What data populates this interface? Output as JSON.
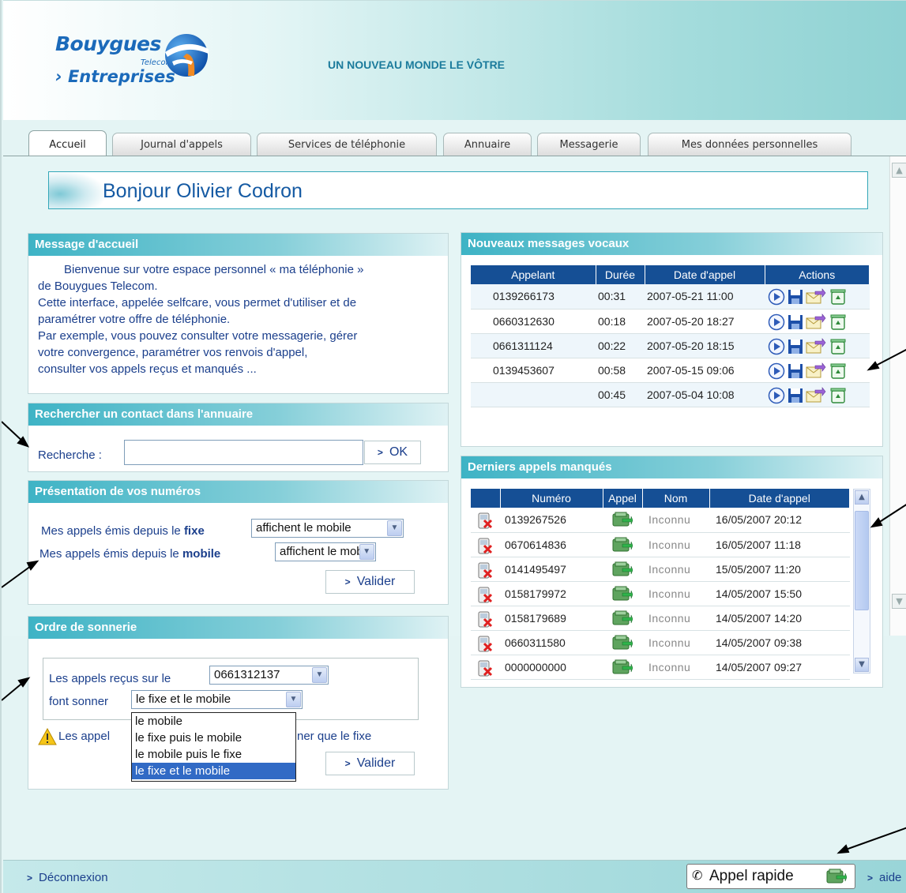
{
  "header": {
    "brand_line1": "Bouygues",
    "brand_line2": "Telecom",
    "brand_line3": "› Entreprises",
    "slogan": "UN NOUVEAU MONDE LE VÔTRE"
  },
  "tabs": [
    {
      "label": "Accueil",
      "active": true
    },
    {
      "label": "Journal d'appels"
    },
    {
      "label": "Services de téléphonie"
    },
    {
      "label": "Annuaire"
    },
    {
      "label": "Messagerie"
    },
    {
      "label": "Mes données personnelles"
    }
  ],
  "greeting": "Bonjour Olivier Codron",
  "welcome": {
    "title": "Message d'accueil",
    "lines": [
      "Bienvenue sur votre espace personnel « ma téléphonie »",
      "de Bouygues Telecom.",
      "Cette interface, appelée selfcare, vous permet d'utiliser et de",
      "paramétrer votre offre de téléphonie.",
      "Par exemple, vous pouvez consulter votre messagerie, gérer",
      "votre convergence, paramétrer vos renvois d'appel,",
      "consulter vos appels reçus et manqués ..."
    ]
  },
  "search": {
    "title": "Rechercher un contact dans l'annuaire",
    "label": "Recherche :",
    "value": "",
    "button": "OK"
  },
  "numbers": {
    "title": "Présentation de vos numéros",
    "row1_prefix": "Mes appels émis depuis le ",
    "row1_bold": "fixe",
    "row1_value": "affichent le mobile",
    "row2_prefix": "Mes appels émis depuis le ",
    "row2_bold": "mobile",
    "row2_value": "affichent le mobile",
    "button": "Valider"
  },
  "ring": {
    "title": "Ordre de sonnerie",
    "row1_label": "Les appels reçus sur le",
    "row1_value": "0661312137",
    "row2_label": "font sonner",
    "row2_value": "le fixe et le mobile",
    "warning_start": "Les appel",
    "warning_end": "ner que le fixe",
    "button": "Valider",
    "options": [
      "le mobile",
      "le fixe puis le mobile",
      "le mobile puis le fixe",
      "le fixe et le mobile"
    ],
    "selected_index": 3
  },
  "voicemail": {
    "title": "Nouveaux messages vocaux",
    "columns": [
      "Appelant",
      "Durée",
      "Date d'appel",
      "Actions"
    ],
    "rows": [
      {
        "caller": "0139266173",
        "duration": "00:31",
        "date": "2007-05-21 11:00"
      },
      {
        "caller": "0660312630",
        "duration": "00:18",
        "date": "2007-05-20 18:27"
      },
      {
        "caller": "0661311124",
        "duration": "00:22",
        "date": "2007-05-20 18:15"
      },
      {
        "caller": "0139453607",
        "duration": "00:58",
        "date": "2007-05-15 09:06"
      },
      {
        "caller": "",
        "duration": "00:45",
        "date": "2007-05-04 10:08"
      }
    ]
  },
  "missed": {
    "title": "Derniers appels manqués",
    "columns": [
      "Numéro",
      "Appel",
      "Nom",
      "Date d'appel"
    ],
    "rows": [
      {
        "number": "0139267526",
        "name": "Inconnu",
        "date": "16/05/2007 20:12"
      },
      {
        "number": "0670614836",
        "name": "Inconnu",
        "date": "16/05/2007 11:18"
      },
      {
        "number": "0141495497",
        "name": "Inconnu",
        "date": "15/05/2007 11:20"
      },
      {
        "number": "0158179972",
        "name": "Inconnu",
        "date": "14/05/2007 15:50"
      },
      {
        "number": "0158179689",
        "name": "Inconnu",
        "date": "14/05/2007 14:20"
      },
      {
        "number": "0660311580",
        "name": "Inconnu",
        "date": "14/05/2007 09:38"
      },
      {
        "number": "0000000000",
        "name": "Inconnu",
        "date": "14/05/2007 09:27"
      }
    ]
  },
  "footer": {
    "logout": "Déconnexion",
    "quick_call": "Appel rapide",
    "help": "aide"
  },
  "colors": {
    "header_navy": "#154f95",
    "panel_teal": "#3eb3c5",
    "text_blue": "#1b3f8c",
    "background": "#e5f5f5"
  }
}
